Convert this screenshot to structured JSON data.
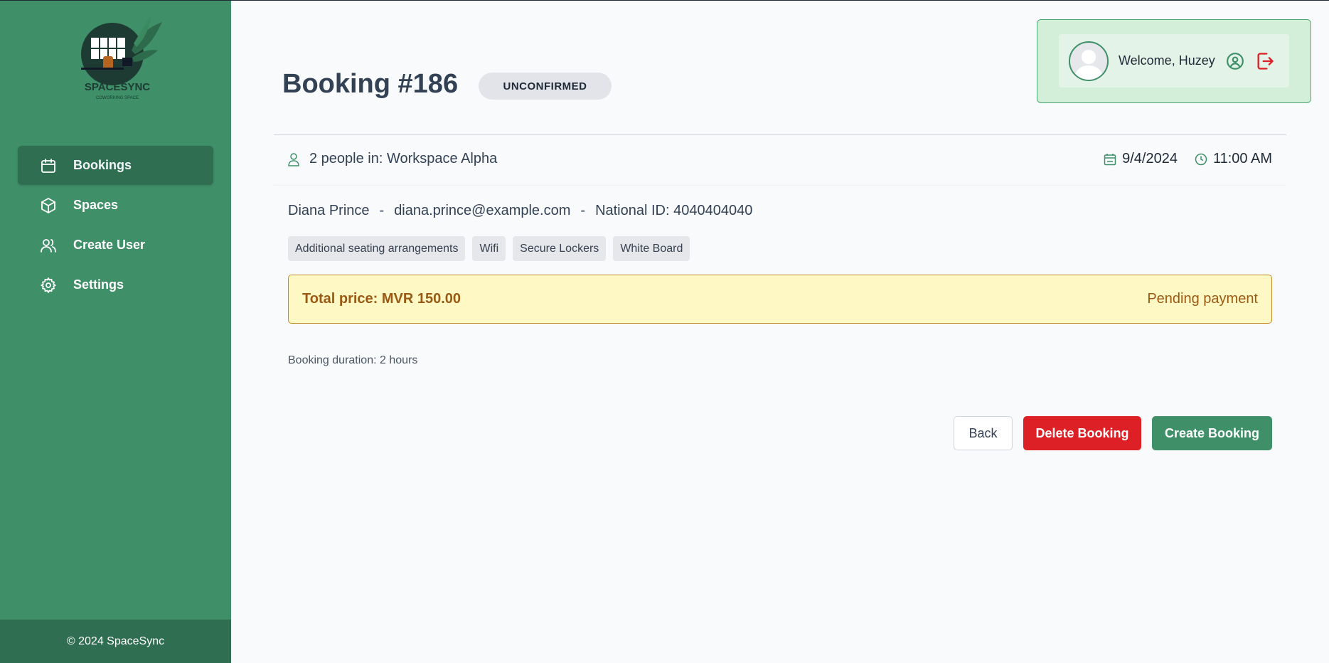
{
  "brand": {
    "name": "SPACESYNC",
    "tagline": "COWORKING SPACE"
  },
  "sidebar": {
    "items": [
      {
        "label": "Bookings",
        "icon": "calendar-icon",
        "active": true
      },
      {
        "label": "Spaces",
        "icon": "cube-icon",
        "active": false
      },
      {
        "label": "Create User",
        "icon": "users-icon",
        "active": false
      },
      {
        "label": "Settings",
        "icon": "gear-icon",
        "active": false
      }
    ],
    "footer": "© 2024 SpaceSync"
  },
  "user": {
    "welcome": "Welcome, Huzey",
    "profile_icon": "user-circle-icon",
    "logout_icon": "logout-icon"
  },
  "booking": {
    "title": "Booking #186",
    "status": "UNCONFIRMED",
    "people_text": "2 people in: Workspace Alpha",
    "date": "9/4/2024",
    "time": "11:00 AM",
    "customer_name": "Diana Prince",
    "customer_email": "diana.prince@example.com",
    "national_id": "National ID: 4040404040",
    "separator": "-",
    "amenities": [
      "Additional seating arrangements",
      "Wifi",
      "Secure Lockers",
      "White Board"
    ],
    "total_price": "Total price: MVR 150.00",
    "payment_status": "Pending payment",
    "duration": "Booking duration: 2 hours"
  },
  "actions": {
    "back": "Back",
    "delete": "Delete Booking",
    "create": "Create Booking"
  },
  "colors": {
    "sidebar": "#3f8f69",
    "sidebar_dark": "#2f6e50",
    "danger": "#dc2026",
    "warning_bg": "#fef8c4",
    "warning_text": "#9a5a13"
  }
}
